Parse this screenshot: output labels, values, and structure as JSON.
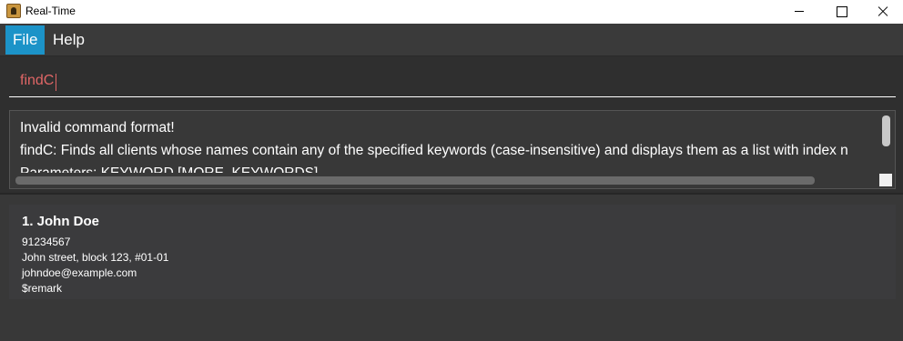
{
  "window": {
    "title": "Real-Time"
  },
  "menu": {
    "file": "File",
    "help": "Help"
  },
  "command": {
    "value": "findC"
  },
  "result": {
    "lines": [
      "Invalid command format!",
      "findC: Finds all clients whose names contain any of the specified keywords (case-insensitive) and displays them as a list with index n",
      "Parameters: KEYWORD [MORE_KEYWORDS]..."
    ]
  },
  "persons": [
    {
      "index_name": "1.  John Doe",
      "phone": "91234567",
      "address": "John street, block 123, #01-01",
      "email": "johndoe@example.com",
      "remark": "$remark"
    }
  ],
  "icons": {
    "app": "app-icon",
    "minimize": "minimize-icon",
    "maximize": "maximize-icon",
    "close": "close-icon"
  },
  "colors": {
    "accent": "#1c93c8",
    "error_text": "#e06666",
    "background": "#2f2f2f"
  }
}
